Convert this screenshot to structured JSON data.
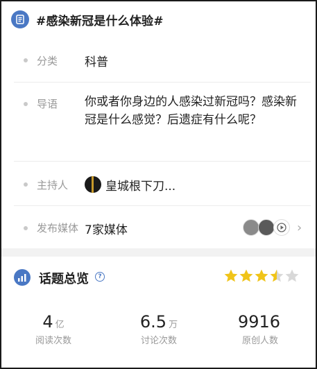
{
  "topic": {
    "title": "#感染新冠是什么体验#",
    "icon": "document-icon"
  },
  "info": {
    "category": {
      "label": "分类",
      "value": "科普"
    },
    "intro": {
      "label": "导语",
      "value": "你或者你身边的人感染过新冠吗？感染新冠是什么感觉？后遗症有什么呢？"
    },
    "host": {
      "label": "主持人",
      "name": "皇城根下刀..."
    },
    "media": {
      "label": "发布媒体",
      "value": "7家媒体"
    }
  },
  "overview": {
    "title": "话题总览",
    "rating": 3.5,
    "rating_max": 5,
    "stats": [
      {
        "number": "4",
        "unit": "亿",
        "label": "阅读次数"
      },
      {
        "number": "6.5",
        "unit": "万",
        "label": "讨论次数"
      },
      {
        "number": "9916",
        "unit": "",
        "label": "原创人数"
      }
    ]
  },
  "colors": {
    "accent": "#4a78c4",
    "star_filled": "#f0c419",
    "star_empty": "#d8d8d8"
  }
}
